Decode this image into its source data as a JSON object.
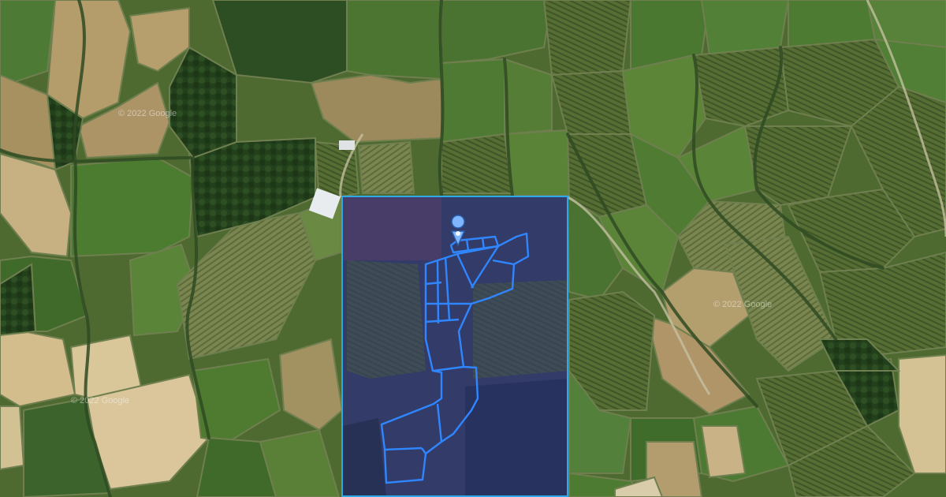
{
  "map": {
    "view": "satellite",
    "watermark": "© 2022 Google",
    "colors": {
      "selection_border": "#2fa8e6",
      "selection_tint": "#2b2e78",
      "parcel_outline": "#2f86ff",
      "marker": "#7fb6ff"
    },
    "icons": {
      "marker": "location-pin-icon"
    }
  }
}
